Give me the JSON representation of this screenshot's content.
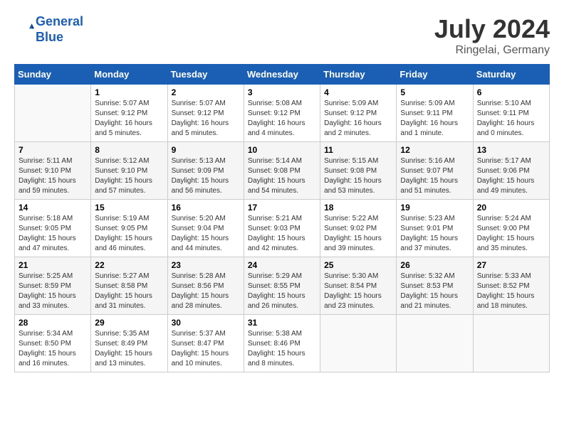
{
  "header": {
    "logo_line1": "General",
    "logo_line2": "Blue",
    "month": "July 2024",
    "location": "Ringelai, Germany"
  },
  "weekdays": [
    "Sunday",
    "Monday",
    "Tuesday",
    "Wednesday",
    "Thursday",
    "Friday",
    "Saturday"
  ],
  "weeks": [
    [
      {
        "day": "",
        "info": ""
      },
      {
        "day": "1",
        "info": "Sunrise: 5:07 AM\nSunset: 9:12 PM\nDaylight: 16 hours\nand 5 minutes."
      },
      {
        "day": "2",
        "info": "Sunrise: 5:07 AM\nSunset: 9:12 PM\nDaylight: 16 hours\nand 5 minutes."
      },
      {
        "day": "3",
        "info": "Sunrise: 5:08 AM\nSunset: 9:12 PM\nDaylight: 16 hours\nand 4 minutes."
      },
      {
        "day": "4",
        "info": "Sunrise: 5:09 AM\nSunset: 9:12 PM\nDaylight: 16 hours\nand 2 minutes."
      },
      {
        "day": "5",
        "info": "Sunrise: 5:09 AM\nSunset: 9:11 PM\nDaylight: 16 hours\nand 1 minute."
      },
      {
        "day": "6",
        "info": "Sunrise: 5:10 AM\nSunset: 9:11 PM\nDaylight: 16 hours\nand 0 minutes."
      }
    ],
    [
      {
        "day": "7",
        "info": "Sunrise: 5:11 AM\nSunset: 9:10 PM\nDaylight: 15 hours\nand 59 minutes."
      },
      {
        "day": "8",
        "info": "Sunrise: 5:12 AM\nSunset: 9:10 PM\nDaylight: 15 hours\nand 57 minutes."
      },
      {
        "day": "9",
        "info": "Sunrise: 5:13 AM\nSunset: 9:09 PM\nDaylight: 15 hours\nand 56 minutes."
      },
      {
        "day": "10",
        "info": "Sunrise: 5:14 AM\nSunset: 9:08 PM\nDaylight: 15 hours\nand 54 minutes."
      },
      {
        "day": "11",
        "info": "Sunrise: 5:15 AM\nSunset: 9:08 PM\nDaylight: 15 hours\nand 53 minutes."
      },
      {
        "day": "12",
        "info": "Sunrise: 5:16 AM\nSunset: 9:07 PM\nDaylight: 15 hours\nand 51 minutes."
      },
      {
        "day": "13",
        "info": "Sunrise: 5:17 AM\nSunset: 9:06 PM\nDaylight: 15 hours\nand 49 minutes."
      }
    ],
    [
      {
        "day": "14",
        "info": "Sunrise: 5:18 AM\nSunset: 9:05 PM\nDaylight: 15 hours\nand 47 minutes."
      },
      {
        "day": "15",
        "info": "Sunrise: 5:19 AM\nSunset: 9:05 PM\nDaylight: 15 hours\nand 46 minutes."
      },
      {
        "day": "16",
        "info": "Sunrise: 5:20 AM\nSunset: 9:04 PM\nDaylight: 15 hours\nand 44 minutes."
      },
      {
        "day": "17",
        "info": "Sunrise: 5:21 AM\nSunset: 9:03 PM\nDaylight: 15 hours\nand 42 minutes."
      },
      {
        "day": "18",
        "info": "Sunrise: 5:22 AM\nSunset: 9:02 PM\nDaylight: 15 hours\nand 39 minutes."
      },
      {
        "day": "19",
        "info": "Sunrise: 5:23 AM\nSunset: 9:01 PM\nDaylight: 15 hours\nand 37 minutes."
      },
      {
        "day": "20",
        "info": "Sunrise: 5:24 AM\nSunset: 9:00 PM\nDaylight: 15 hours\nand 35 minutes."
      }
    ],
    [
      {
        "day": "21",
        "info": "Sunrise: 5:25 AM\nSunset: 8:59 PM\nDaylight: 15 hours\nand 33 minutes."
      },
      {
        "day": "22",
        "info": "Sunrise: 5:27 AM\nSunset: 8:58 PM\nDaylight: 15 hours\nand 31 minutes."
      },
      {
        "day": "23",
        "info": "Sunrise: 5:28 AM\nSunset: 8:56 PM\nDaylight: 15 hours\nand 28 minutes."
      },
      {
        "day": "24",
        "info": "Sunrise: 5:29 AM\nSunset: 8:55 PM\nDaylight: 15 hours\nand 26 minutes."
      },
      {
        "day": "25",
        "info": "Sunrise: 5:30 AM\nSunset: 8:54 PM\nDaylight: 15 hours\nand 23 minutes."
      },
      {
        "day": "26",
        "info": "Sunrise: 5:32 AM\nSunset: 8:53 PM\nDaylight: 15 hours\nand 21 minutes."
      },
      {
        "day": "27",
        "info": "Sunrise: 5:33 AM\nSunset: 8:52 PM\nDaylight: 15 hours\nand 18 minutes."
      }
    ],
    [
      {
        "day": "28",
        "info": "Sunrise: 5:34 AM\nSunset: 8:50 PM\nDaylight: 15 hours\nand 16 minutes."
      },
      {
        "day": "29",
        "info": "Sunrise: 5:35 AM\nSunset: 8:49 PM\nDaylight: 15 hours\nand 13 minutes."
      },
      {
        "day": "30",
        "info": "Sunrise: 5:37 AM\nSunset: 8:47 PM\nDaylight: 15 hours\nand 10 minutes."
      },
      {
        "day": "31",
        "info": "Sunrise: 5:38 AM\nSunset: 8:46 PM\nDaylight: 15 hours\nand 8 minutes."
      },
      {
        "day": "",
        "info": ""
      },
      {
        "day": "",
        "info": ""
      },
      {
        "day": "",
        "info": ""
      }
    ]
  ]
}
